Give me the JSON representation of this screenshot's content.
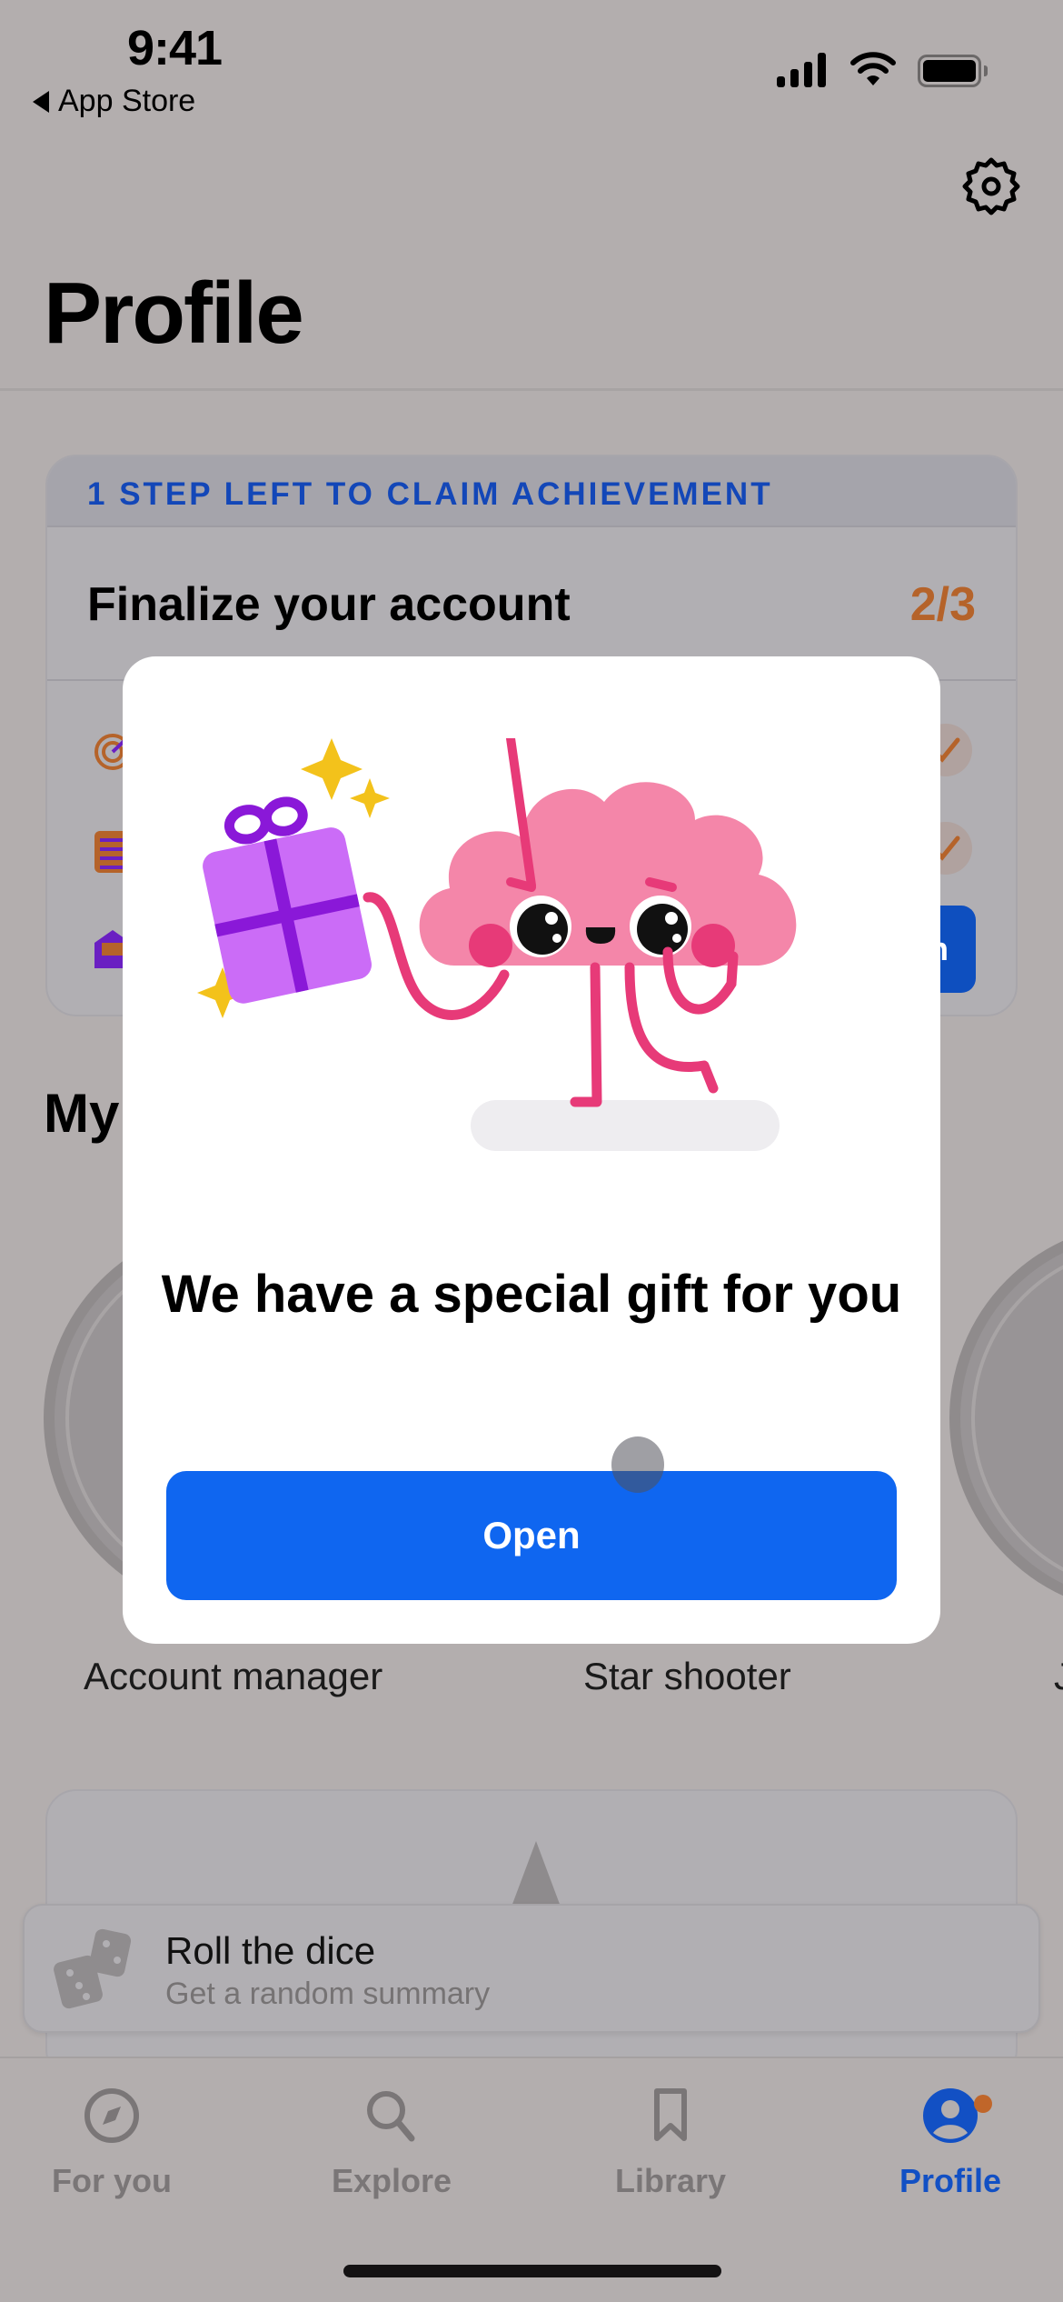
{
  "status_bar": {
    "time": "9:41",
    "back_label": "App Store"
  },
  "header": {
    "title": "Profile",
    "settings_icon": "gear-icon"
  },
  "achievement": {
    "banner": "1 STEP LEFT TO CLAIM ACHIEVEMENT",
    "title": "Finalize your account",
    "progress": "2/3",
    "progress_color": "#b5632a",
    "tasks": [
      {
        "icon": "target-icon",
        "completed": true
      },
      {
        "icon": "list-icon",
        "completed": true
      },
      {
        "icon": "envelope-icon",
        "completed": false,
        "action_label_visible": "n"
      }
    ]
  },
  "badges": {
    "heading": "My",
    "items": [
      {
        "label": "Account manager"
      },
      {
        "label": "Star shooter"
      },
      {
        "label": "J"
      }
    ]
  },
  "roll_dice": {
    "title": "Roll the dice",
    "subtitle": "Get a random summary"
  },
  "tabbar": {
    "items": [
      {
        "label": "For you",
        "icon": "compass-icon",
        "active": false
      },
      {
        "label": "Explore",
        "icon": "search-icon",
        "active": false
      },
      {
        "label": "Library",
        "icon": "bookmark-icon",
        "active": false
      },
      {
        "label": "Profile",
        "icon": "profile-icon",
        "active": true,
        "notification": true
      }
    ],
    "active_color": "#1250c4"
  },
  "modal": {
    "title": "We have a special gift for you",
    "open_label": "Open",
    "button_color": "#0f66f0"
  }
}
